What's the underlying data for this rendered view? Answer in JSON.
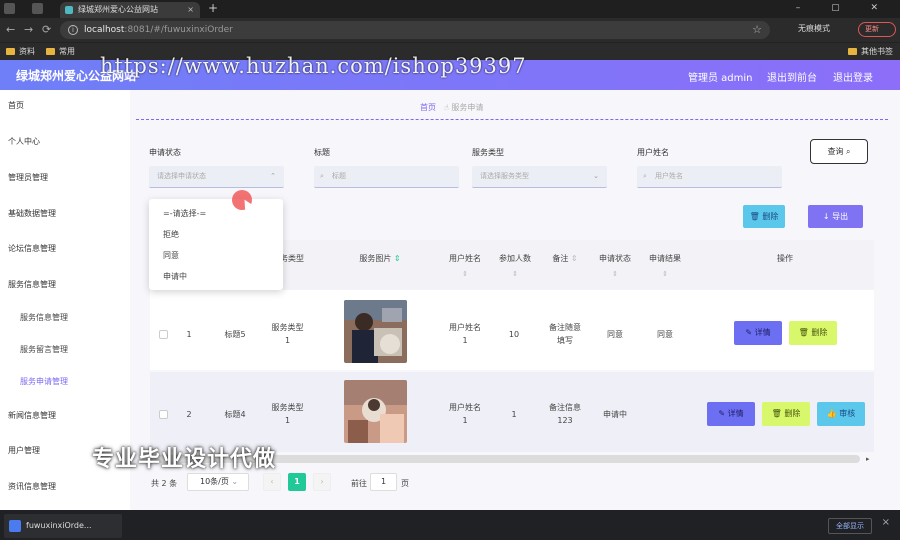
{
  "browser": {
    "tab_title": "绿城郑州爱心公益网站",
    "url_host": "localhost",
    "url_rest": ":8081/#/fuwuxinxiOrder",
    "incognito": "无痕模式",
    "update_label": "更新",
    "bookmarks": [
      "资料",
      "常用"
    ],
    "other_bookmarks": "其他书签"
  },
  "header": {
    "site_title": "绿城郑州爱心公益网站",
    "watermark": "https://www.huzhan.com/ishop39397",
    "admin": "管理员 admin",
    "front": "退出到前台",
    "logout": "退出登录"
  },
  "sidebar": {
    "items": [
      "首页",
      "个人中心",
      "管理员管理",
      "基础数据管理",
      "论坛信息管理",
      "服务信息管理",
      "服务信息管理",
      "服务留言管理",
      "服务申请管理",
      "新闻信息管理",
      "用户管理",
      "资讯信息管理"
    ]
  },
  "breadcrumb": {
    "home": "首页",
    "current": "服务申请"
  },
  "filters": {
    "status_label": "申请状态",
    "status_placeholder": "请选择申请状态",
    "title_label": "标题",
    "title_placeholder": "标题",
    "type_label": "服务类型",
    "type_placeholder": "请选择服务类型",
    "user_label": "用户姓名",
    "user_placeholder": "用户姓名",
    "query": "查询"
  },
  "actions": {
    "delete": "删除",
    "export": "导出"
  },
  "dropdown": {
    "options": [
      "=-请选择-=",
      "拒绝",
      "同意",
      "申请中"
    ]
  },
  "table": {
    "headers": [
      "务类型",
      "服务图片",
      "用户姓名",
      "参加人数",
      "备注",
      "申请状态",
      "申请结果",
      "操作"
    ],
    "rows": [
      {
        "index": "1",
        "title": "标题5",
        "type": "服务类型\n1",
        "user": "用户姓名\n1",
        "count": "10",
        "note": "备注随意\n填写",
        "status": "同意",
        "result": "同意"
      },
      {
        "index": "2",
        "title": "标题4",
        "type": "服务类型\n1",
        "user": "用户姓名\n1",
        "count": "1",
        "note": "备注信息\n123",
        "status": "申请中",
        "result": ""
      }
    ],
    "btn_detail": "详情",
    "btn_delete": "删除",
    "btn_audit": "审核"
  },
  "overlay_text": "专业毕业设计代做",
  "pagination": {
    "total": "共 2 条",
    "page_size": "10条/页",
    "current": "1",
    "goto": "前往",
    "goto_value": "1",
    "page_unit": "页"
  },
  "taskbar": {
    "download": "fuwuxinxiOrde...",
    "show_all": "全部显示"
  }
}
